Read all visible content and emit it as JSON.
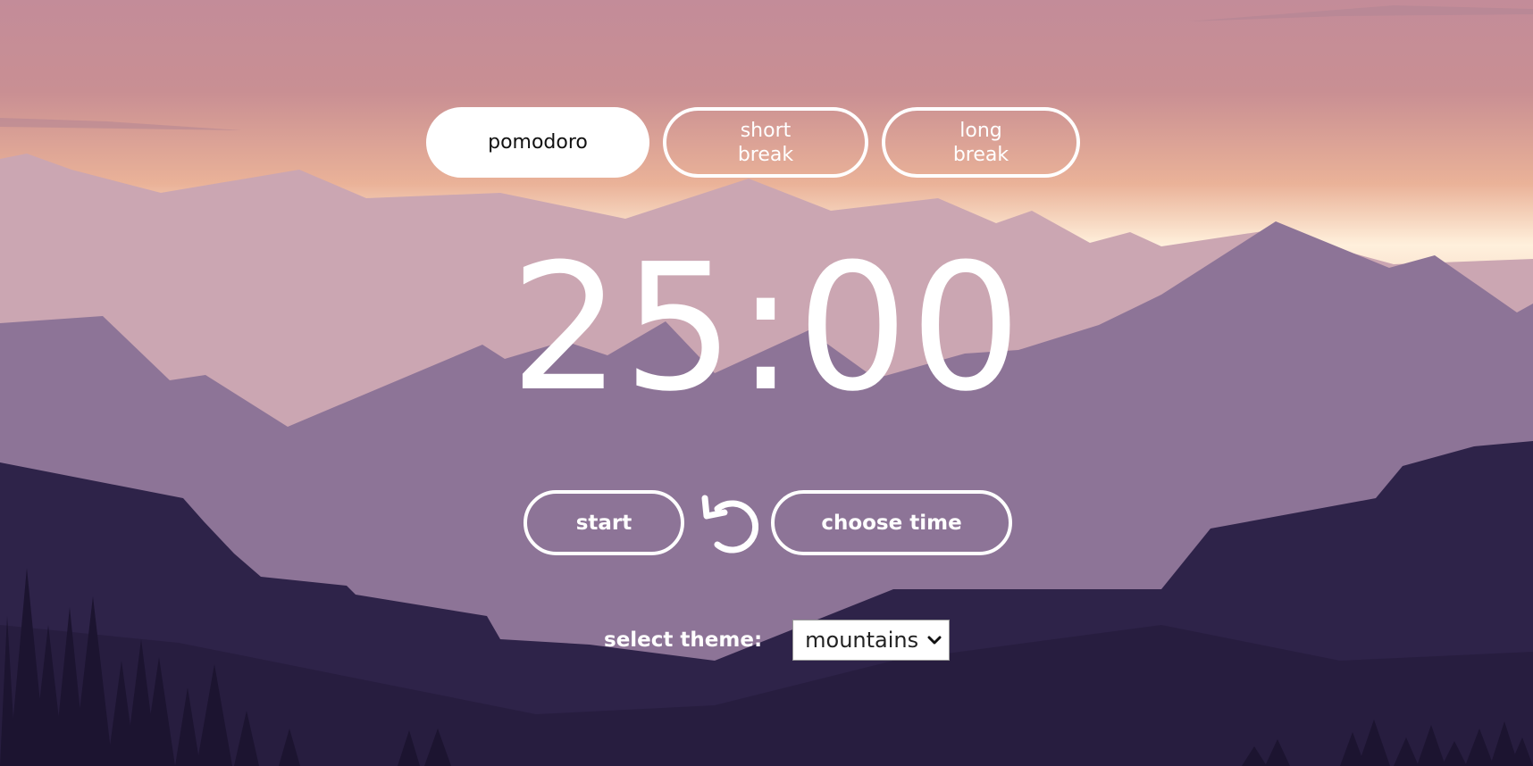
{
  "colors": {
    "sky_top": "#c38c99",
    "sky_glow": "#efb89a",
    "far_mountains": "#cba6b2",
    "mid_mountains": "#8d7497",
    "dark_hills": "#2e2349",
    "trees": "#1c1430",
    "accent": "#ffffff"
  },
  "tabs": [
    {
      "label": "pomodoro",
      "active": true
    },
    {
      "label": "short\nbreak",
      "active": false
    },
    {
      "label": "long\nbreak",
      "active": false
    }
  ],
  "timer": {
    "display": "25:00"
  },
  "controls": {
    "start_label": "start",
    "reset_icon": "reset-icon",
    "choose_time_label": "choose time"
  },
  "theme": {
    "label": "select theme:",
    "selected": "mountains",
    "chevron_icon": "chevron-down-icon"
  }
}
